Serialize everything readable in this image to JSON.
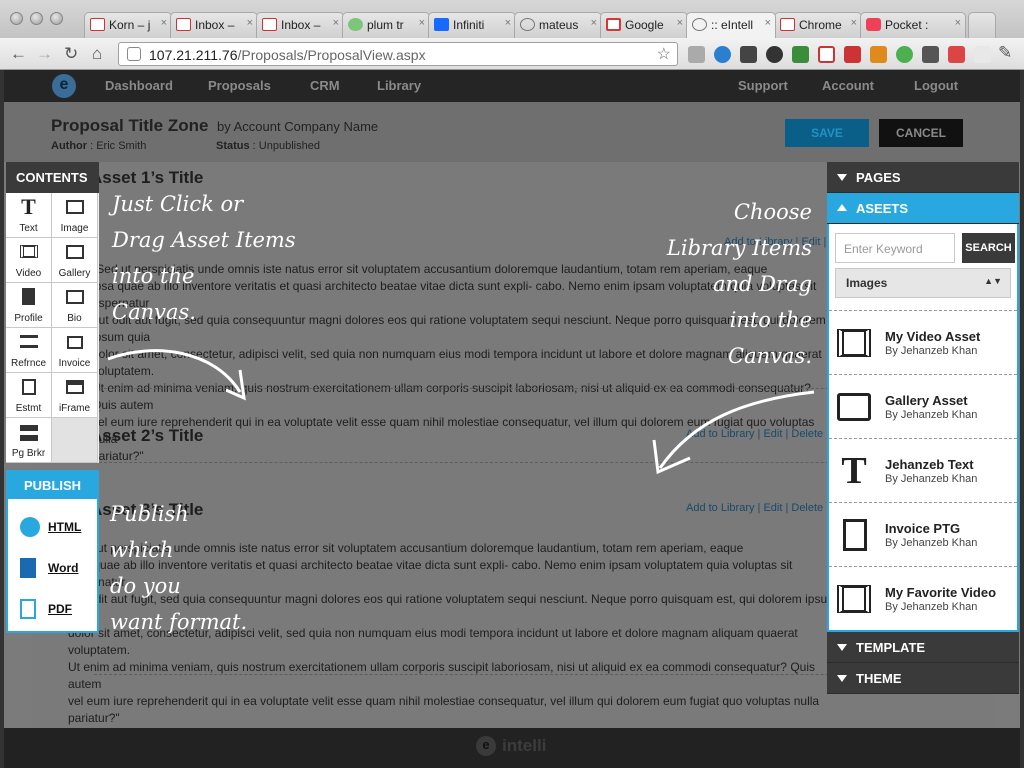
{
  "browser": {
    "tabs": [
      {
        "title": "Korn – j",
        "icon": "gmail-icon"
      },
      {
        "title": "Inbox – ",
        "icon": "gmail-icon"
      },
      {
        "title": "Inbox – ",
        "icon": "gmail-icon"
      },
      {
        "title": "plum tr",
        "icon": "cloud-icon"
      },
      {
        "title": "Infiniti ",
        "icon": "behance-icon"
      },
      {
        "title": "mateus",
        "icon": "globe-icon"
      },
      {
        "title": "Google ",
        "icon": "google-icon"
      },
      {
        "title": ":: eIntell",
        "icon": "globe-icon"
      },
      {
        "title": "Chrome",
        "icon": "chrome-icon"
      },
      {
        "title": "Pocket :",
        "icon": "pocket-icon"
      }
    ],
    "url_host": "107.21.211.76",
    "url_path": "/Proposals/ProposalView.aspx"
  },
  "nav": {
    "logo": "e",
    "items": [
      "Dashboard",
      "Proposals",
      "CRM",
      "Library"
    ],
    "right": [
      "Support",
      "Account",
      "Logout"
    ]
  },
  "proposal": {
    "title": "Proposal Title Zone",
    "company": "by Account Company Name",
    "author_label": "Author",
    "author": "Eric Smith",
    "status_label": "Status",
    "status": "Unpublished",
    "save": "SAVE",
    "cancel": "CANCEL"
  },
  "canvas": {
    "asset1_title": "Asset 1’s Title",
    "asset2_title": "Asset 2’s Title",
    "asset3_title": "Asset 3’s Title",
    "links": "Add to Library | Edit | Delete",
    "para1": [
      "\"Sed ut perspiciatis unde omnis iste natus error sit voluptatem accusantium doloremque laudantium, totam rem aperiam, eaque",
      "ipsa quae ab illo inventore veritatis et quasi architecto beatae vitae dicta sunt expli- cabo. Nemo enim ipsam voluptatem quia voluptas sit aspernatur",
      "aut odit aut fugit, sed quia consequuntur magni dolores eos qui ratione voluptatem sequi nesciunt. Neque porro quisquam est, qui dolorem ipsum quia",
      "dolor sit amet, consectetur, adipisci velit, sed quia non numquam eius modi tempora incidunt ut labore et dolore magnam aliquam quaerat voluptatem.",
      "Ut enim ad minima veniam, quis nostrum exercitationem ullam corporis suscipit laboriosam, nisi ut aliquid ex ea commodi consequatur? Quis autem",
      "vel eum iure reprehenderit qui in ea voluptate velit esse quam nihil molestiae consequatur, vel illum qui dolorem eum fugiat quo voluptas nulla",
      "pariatur?\""
    ],
    "para3": [
      "\"Sed ut perspiciatis unde omnis iste natus error sit voluptatem accusantium doloremque laudantium, totam rem aperiam, eaque",
      "ipsa quae ab illo inventore veritatis et quasi architecto beatae vitae dicta sunt expli- cabo. Nemo enim ipsam voluptatem quia voluptas sit aspernatur",
      "aut odit aut fugit, sed quia consequuntur magni dolores eos qui ratione voluptatem sequi nesciunt. Neque porro quisquam est, qui dolorem ipsum quia",
      "dolor sit amet, consectetur, adipisci velit, sed quia non numquam eius modi tempora incidunt ut labore et dolore magnam aliquam quaerat voluptatem.",
      "Ut enim ad minima veniam, quis nostrum exercitationem ullam corporis suscipit laboriosam, nisi ut aliquid ex ea commodi consequatur? Quis autem",
      "vel eum iure reprehenderit qui in ea voluptate velit esse quam nihil molestiae consequatur, vel illum qui dolorem eum fugiat quo voluptas nulla",
      "pariatur?\""
    ]
  },
  "contents": {
    "header": "CONTENTS",
    "items": [
      {
        "label": "Text",
        "icon": "text-icon"
      },
      {
        "label": "Image",
        "icon": "image-icon"
      },
      {
        "label": "Video",
        "icon": "video-icon"
      },
      {
        "label": "Gallery",
        "icon": "gallery-icon"
      },
      {
        "label": "Profile",
        "icon": "profile-icon"
      },
      {
        "label": "Bio",
        "icon": "bio-icon"
      },
      {
        "label": "Refrnce",
        "icon": "reference-icon"
      },
      {
        "label": "Invoice",
        "icon": "invoice-icon"
      },
      {
        "label": "Estmt",
        "icon": "estimate-icon"
      },
      {
        "label": "iFrame",
        "icon": "iframe-icon"
      },
      {
        "label": "Pg Brkr",
        "icon": "page-break-icon"
      }
    ]
  },
  "publish": {
    "header": "PUBLISH",
    "items": [
      {
        "label": "HTML",
        "icon": "globe-icon"
      },
      {
        "label": "Word",
        "icon": "word-doc-icon"
      },
      {
        "label": "PDF",
        "icon": "pdf-icon"
      }
    ]
  },
  "right_panel": {
    "pages": "PAGES",
    "assets": "ASEETS",
    "search_placeholder": "Enter Keyword",
    "search_button": "SEARCH",
    "filter": "Images",
    "items": [
      {
        "title": "My Video Asset",
        "by": "By Jehanzeb Khan",
        "icon": "video-film-icon"
      },
      {
        "title": "Gallery Asset",
        "by": "By Jehanzeb Khan",
        "icon": "gallery-icon"
      },
      {
        "title": "Jehanzeb Text",
        "by": "By Jehanzeb Khan",
        "icon": "text-icon"
      },
      {
        "title": "Invoice PTG",
        "by": "By Jehanzeb Khan",
        "icon": "invoice-icon"
      },
      {
        "title": "My Favorite Video",
        "by": "By Jehanzeb Khan",
        "icon": "video-film-icon"
      }
    ],
    "template": "TEMPLATE",
    "theme": "THEME"
  },
  "annotations": {
    "left": [
      "Just Click or",
      "Drag Asset Items",
      "into the",
      "Canvas."
    ],
    "right": [
      "Choose",
      "Library Items",
      "and Drag",
      "into the",
      "Canvas."
    ],
    "publish": [
      "Publish",
      "which",
      "do you",
      "want format."
    ]
  },
  "footer": {
    "logo": "e",
    "brand": "intelli"
  },
  "colors": {
    "accent": "#29a8e0",
    "dark": "#3a3a3a"
  }
}
